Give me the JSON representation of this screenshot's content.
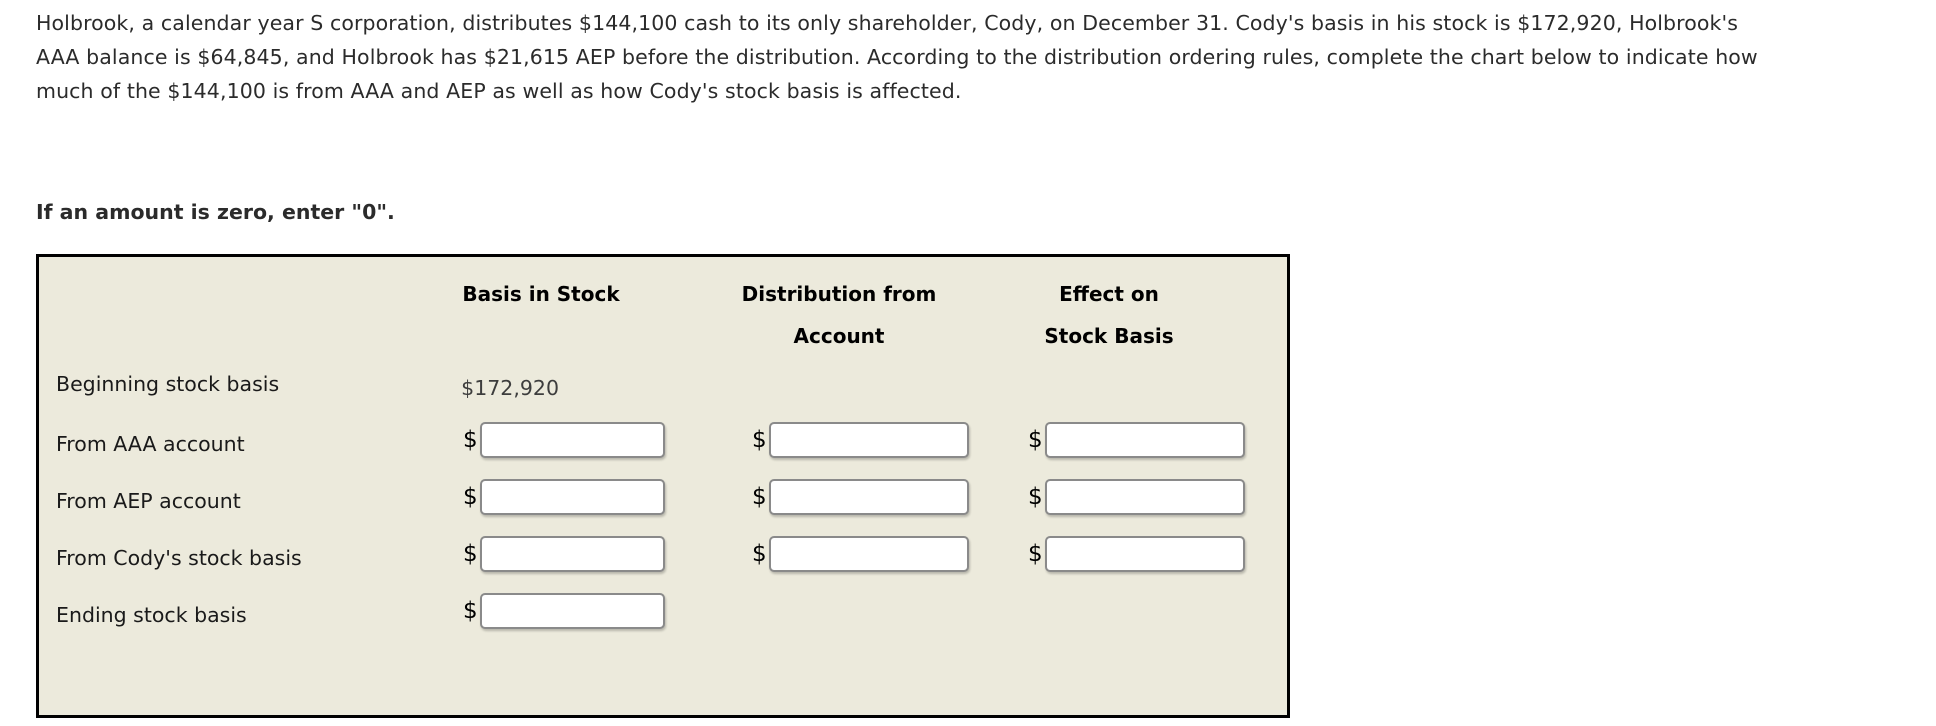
{
  "problem": {
    "statement": "Holbrook, a calendar year S corporation, distributes $144,100 cash to its only shareholder, Cody, on December 31. Cody's basis in his stock is $172,920, Holbrook's AAA balance is $64,845, and Holbrook has $21,615 AEP before the distribution. According to the distribution ordering rules, complete the chart below to indicate how much of the $144,100 is from AAA and AEP as well as how Cody's stock basis is affected.",
    "instruction": "If an amount is zero, enter \"0\"."
  },
  "chart": {
    "columns": [
      {
        "line1": "",
        "line2": "Basis in Stock"
      },
      {
        "line1": "Distribution from",
        "line2": "Account"
      },
      {
        "line1": "Effect on",
        "line2": "Stock Basis"
      }
    ],
    "currency_symbol": "$",
    "rows": [
      {
        "label": "Beginning stock basis",
        "basis_in_stock": {
          "type": "static",
          "value": "$172,920"
        },
        "distribution_from_account": {
          "type": "empty"
        },
        "effect_on_stock_basis": {
          "type": "empty"
        }
      },
      {
        "label": "From AAA account",
        "basis_in_stock": {
          "type": "input",
          "value": "",
          "placeholder": ""
        },
        "distribution_from_account": {
          "type": "input",
          "value": "",
          "placeholder": ""
        },
        "effect_on_stock_basis": {
          "type": "input",
          "value": "",
          "placeholder": ""
        }
      },
      {
        "label": "From AEP account",
        "basis_in_stock": {
          "type": "input",
          "value": "",
          "placeholder": ""
        },
        "distribution_from_account": {
          "type": "input",
          "value": "",
          "placeholder": ""
        },
        "effect_on_stock_basis": {
          "type": "input",
          "value": "",
          "placeholder": ""
        }
      },
      {
        "label": "From Cody's stock basis",
        "basis_in_stock": {
          "type": "input",
          "value": "",
          "placeholder": ""
        },
        "distribution_from_account": {
          "type": "input",
          "value": "",
          "placeholder": ""
        },
        "effect_on_stock_basis": {
          "type": "input",
          "value": "",
          "placeholder": ""
        }
      },
      {
        "label": "Ending stock basis",
        "basis_in_stock": {
          "type": "input",
          "value": "",
          "placeholder": ""
        },
        "distribution_from_account": {
          "type": "empty"
        },
        "effect_on_stock_basis": {
          "type": "empty"
        }
      }
    ]
  },
  "colors": {
    "panel_background": "#ECEADC",
    "panel_border": "#000000",
    "page_background": "#FFFFFF",
    "text": "#262626",
    "input_border": "#8A8A8A",
    "input_background": "#FFFFFF"
  }
}
